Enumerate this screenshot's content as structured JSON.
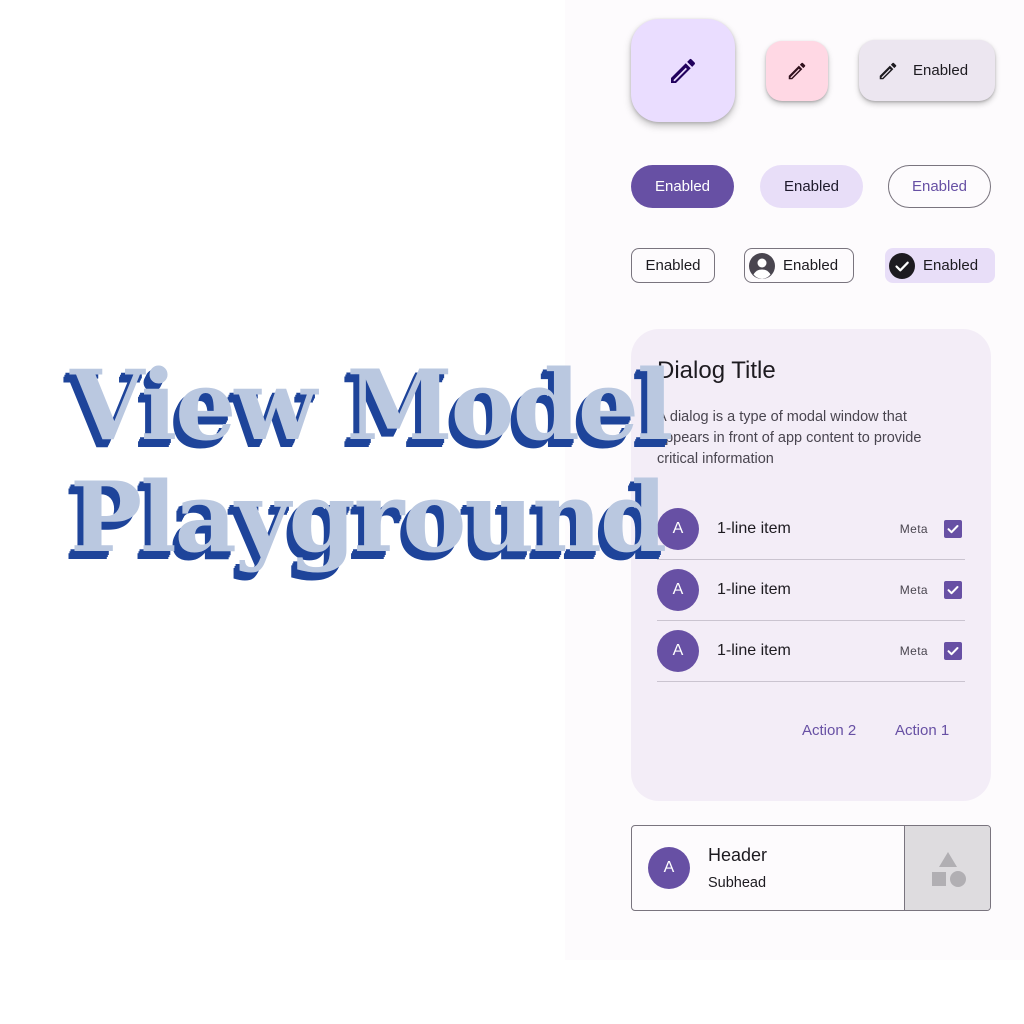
{
  "overlay": {
    "line1": "View Model",
    "line2": "Playground"
  },
  "fabs": {
    "large_icon": "edit-icon",
    "small_icon": "edit-icon",
    "extended_label": "Enabled"
  },
  "buttons": {
    "filled": "Enabled",
    "tonal": "Enabled",
    "outlined": "Enabled"
  },
  "chips": {
    "assist": "Enabled",
    "input": "Enabled",
    "filter": "Enabled"
  },
  "dialog": {
    "title": "Dialog Title",
    "body": "A dialog is a type of modal window that appears in front of app content to provide critical information",
    "items": [
      {
        "avatar": "A",
        "label": "1-line item",
        "meta": "Meta",
        "checked": true
      },
      {
        "avatar": "A",
        "label": "1-line item",
        "meta": "Meta",
        "checked": true
      },
      {
        "avatar": "A",
        "label": "1-line item",
        "meta": "Meta",
        "checked": true
      }
    ],
    "action2": "Action 2",
    "action1": "Action 1"
  },
  "card": {
    "avatar": "A",
    "header": "Header",
    "subhead": "Subhead"
  },
  "colors": {
    "primary": "#6750a4",
    "primary_container": "#eaddff",
    "tertiary_container": "#ffd8e4",
    "secondary_container": "#e8def8",
    "surface": "#f3edf7",
    "title_fill": "#bac8e0",
    "title_shadow": "#1e449a"
  }
}
